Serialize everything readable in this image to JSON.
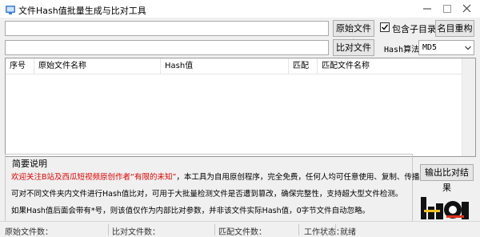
{
  "window": {
    "title": "文件Hash值批量生成与比对工具"
  },
  "controls": {
    "original_folder_btn": "原始文件夹",
    "compare_folder_btn": "比对文件夹",
    "include_subdirs_label": "包含子目录",
    "include_subdirs_checked": true,
    "rename_btn": "名目重构",
    "hash_algo_label": "Hash算法：",
    "hash_algo_value": "MD5",
    "export_btn": "输出比对结果"
  },
  "table": {
    "columns": [
      "序号",
      "原始文件名称",
      "Hash值",
      "匹配",
      "匹配文件名称"
    ],
    "rows": []
  },
  "info": {
    "title": "简要说明",
    "line1_red": "欢迎关注B站及西瓜短视频原创作者“有限的未知”",
    "line1_black": "，本工具为自用原创程序，完全免费，任何人均可任意使用、复制、传播。",
    "line2": "可对不同文件夹内文件进行Hash值比对，可用于大批量检测文件是否遭到篡改，确保完整性，支持超大型文件检测。",
    "line3": "如果Hash值后面会带有*号，则该值仅作为内部比对参数，并非该文件实际Hash值，0字节文件自动忽略。"
  },
  "status": {
    "original_count_label": "原始文件数：",
    "original_count_value": "",
    "compare_count_label": "比对文件数：",
    "compare_count_value": "",
    "match_count_label": "匹配文件数：",
    "match_count_value": "",
    "work_state_label": "工作状态：",
    "work_state_value": "就绪"
  },
  "colors": {
    "accent_red": "#e00000",
    "client_bg": "#f0f0f0"
  }
}
